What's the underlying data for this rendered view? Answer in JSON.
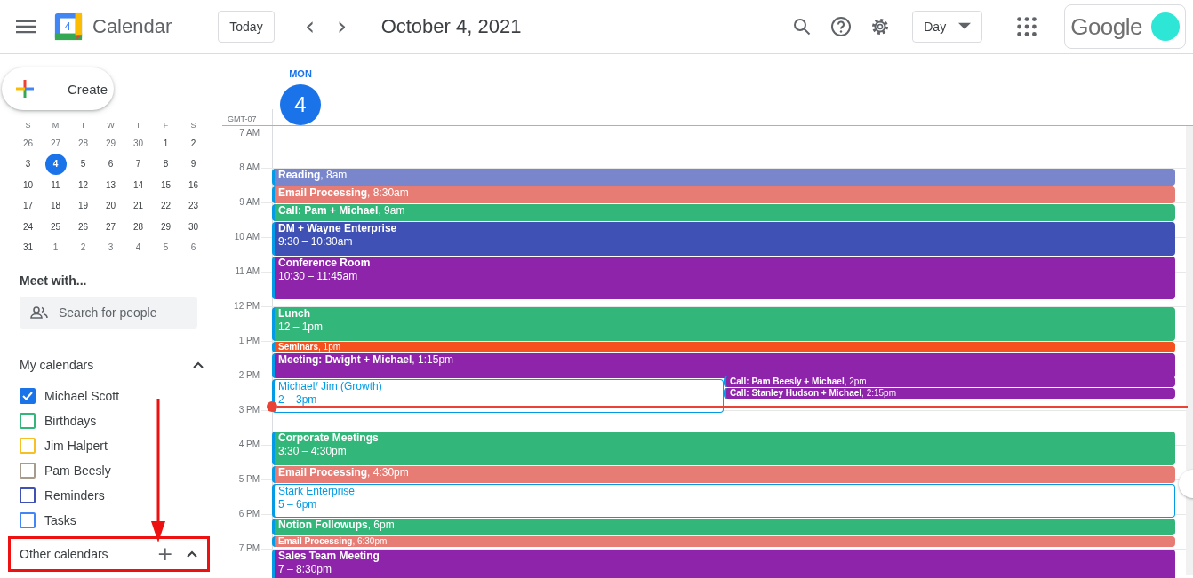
{
  "header": {
    "app_name": "Calendar",
    "logo_day": "4",
    "today_button": "Today",
    "prev": "‹",
    "next": "›",
    "date_title": "October 4, 2021",
    "view_select": "Day",
    "account_brand": "Google"
  },
  "sidebar": {
    "create_button": "Create",
    "mini_calendar": {
      "weekdays": [
        "S",
        "M",
        "T",
        "W",
        "T",
        "F",
        "S"
      ],
      "weeks": [
        [
          {
            "day": "26",
            "other_month": true,
            "selected": false
          },
          {
            "day": "27",
            "other_month": true,
            "selected": false
          },
          {
            "day": "28",
            "other_month": true,
            "selected": false
          },
          {
            "day": "29",
            "other_month": true,
            "selected": false
          },
          {
            "day": "30",
            "other_month": true,
            "selected": false
          },
          {
            "day": "1",
            "other_month": false,
            "selected": false
          },
          {
            "day": "2",
            "other_month": false,
            "selected": false
          }
        ],
        [
          {
            "day": "3",
            "other_month": false,
            "selected": false
          },
          {
            "day": "4",
            "other_month": false,
            "selected": true
          },
          {
            "day": "5",
            "other_month": false,
            "selected": false
          },
          {
            "day": "6",
            "other_month": false,
            "selected": false
          },
          {
            "day": "7",
            "other_month": false,
            "selected": false
          },
          {
            "day": "8",
            "other_month": false,
            "selected": false
          },
          {
            "day": "9",
            "other_month": false,
            "selected": false
          }
        ],
        [
          {
            "day": "10",
            "other_month": false,
            "selected": false
          },
          {
            "day": "11",
            "other_month": false,
            "selected": false
          },
          {
            "day": "12",
            "other_month": false,
            "selected": false
          },
          {
            "day": "13",
            "other_month": false,
            "selected": false
          },
          {
            "day": "14",
            "other_month": false,
            "selected": false
          },
          {
            "day": "15",
            "other_month": false,
            "selected": false
          },
          {
            "day": "16",
            "other_month": false,
            "selected": false
          }
        ],
        [
          {
            "day": "17",
            "other_month": false,
            "selected": false
          },
          {
            "day": "18",
            "other_month": false,
            "selected": false
          },
          {
            "day": "19",
            "other_month": false,
            "selected": false
          },
          {
            "day": "20",
            "other_month": false,
            "selected": false
          },
          {
            "day": "21",
            "other_month": false,
            "selected": false
          },
          {
            "day": "22",
            "other_month": false,
            "selected": false
          },
          {
            "day": "23",
            "other_month": false,
            "selected": false
          }
        ],
        [
          {
            "day": "24",
            "other_month": false,
            "selected": false
          },
          {
            "day": "25",
            "other_month": false,
            "selected": false
          },
          {
            "day": "26",
            "other_month": false,
            "selected": false
          },
          {
            "day": "27",
            "other_month": false,
            "selected": false
          },
          {
            "day": "28",
            "other_month": false,
            "selected": false
          },
          {
            "day": "29",
            "other_month": false,
            "selected": false
          },
          {
            "day": "30",
            "other_month": false,
            "selected": false
          }
        ],
        [
          {
            "day": "31",
            "other_month": false,
            "selected": false
          },
          {
            "day": "1",
            "other_month": true,
            "selected": false
          },
          {
            "day": "2",
            "other_month": true,
            "selected": false
          },
          {
            "day": "3",
            "other_month": true,
            "selected": false
          },
          {
            "day": "4",
            "other_month": true,
            "selected": false
          },
          {
            "day": "5",
            "other_month": true,
            "selected": false
          },
          {
            "day": "6",
            "other_month": true,
            "selected": false
          }
        ]
      ]
    },
    "meet_with": {
      "title": "Meet with...",
      "placeholder": "Search for people"
    },
    "my_calendars": {
      "title": "My calendars",
      "expanded": true,
      "items": [
        {
          "label": "Michael Scott",
          "checked": true,
          "color": "#1a73e8"
        },
        {
          "label": "Birthdays",
          "checked": false,
          "color": "#33b679"
        },
        {
          "label": "Jim Halpert",
          "checked": false,
          "color": "#f6bf26"
        },
        {
          "label": "Pam Beesly",
          "checked": false,
          "color": "#a79b8e"
        },
        {
          "label": "Reminders",
          "checked": false,
          "color": "#3f51b5"
        },
        {
          "label": "Tasks",
          "checked": false,
          "color": "#4285f4"
        }
      ]
    },
    "other_calendars": {
      "title": "Other calendars",
      "add": "+",
      "expanded": true,
      "highlighted": true
    }
  },
  "day_view": {
    "weekday": "MON",
    "day": "4",
    "timezone": "GMT-07",
    "hours": [
      {
        "label": "7 AM",
        "now": false
      },
      {
        "label": "8 AM",
        "now": false,
        "events": [
          {
            "title": "**Reading**, 8am",
            "kind": "bar",
            "color": "#7986cb"
          },
          {
            "title": "**Email Processing**, 8:30am",
            "kind": "bar",
            "color": "#e67c73"
          }
        ]
      },
      {
        "label": "9 AM",
        "now": false,
        "events": [
          {
            "title": "**Call: Pam + Michael**, 9am",
            "kind": "bar",
            "color": "#33b679"
          },
          {
            "title": "DM + Wayne Enterprise",
            "time": "9:30 – 10:30am",
            "kind": "block",
            "color": "#3f51b5"
          }
        ]
      },
      {
        "label": "10 AM",
        "now": false,
        "events": [
          {
            "title": "Conference Room",
            "time": "10:30 – 11:45am",
            "kind": "tall",
            "color": "#8e24aa"
          }
        ]
      },
      {
        "label": "11 AM",
        "now": false
      },
      {
        "label": "12 PM",
        "now": false,
        "events": [
          {
            "title": "Lunch",
            "time": "12 – 1pm",
            "kind": "block",
            "color": "#33b679"
          }
        ]
      },
      {
        "label": "1 PM",
        "now": false,
        "events": [
          {
            "title": "**Seminars**, 1pm",
            "kind": "thin",
            "color": "#f4511e"
          },
          {
            "title": "**Meeting: Dwight + Michael**, 1:15pm",
            "kind": "medium",
            "color": "#8e24aa"
          }
        ]
      },
      {
        "label": "2 PM",
        "now": true,
        "events": [
          {
            "title": "Michael/ Jim (Growth)",
            "time": "2 – 3pm",
            "kind": "overlap",
            "color": "#039be5"
          },
          {
            "title": "**Call: Pam Beesly + Michael**, 2pm",
            "kind": "side",
            "color": "#8e24aa"
          },
          {
            "title": "**Call: Stanley Hudson + Michael**, 2:15pm",
            "kind": "side",
            "color": "#8e24aa"
          }
        ]
      },
      {
        "label": "3 PM",
        "now": false,
        "events": [
          {
            "title": "Corporate Meetings",
            "time": "3:30 – 4:30pm",
            "kind": "delayed",
            "color": "#33b679"
          }
        ]
      },
      {
        "label": "4 PM",
        "now": false,
        "events": [
          {
            "title": "**Email Processing**, 4:30pm",
            "kind": "bar",
            "color": "#e67c73"
          }
        ]
      },
      {
        "label": "5 PM",
        "now": false,
        "events": [
          {
            "title": "Stark Enterprise",
            "time": "5 – 6pm",
            "kind": "outlined",
            "color": "#039be5"
          }
        ]
      },
      {
        "label": "6 PM",
        "now": false,
        "events": [
          {
            "title": "**Notion Followups**, 6pm",
            "kind": "bar",
            "color": "#33b679"
          },
          {
            "title": "**Email Processing**, 6:30pm",
            "kind": "thin",
            "color": "#e67c73"
          }
        ]
      },
      {
        "label": "7 PM",
        "now": false,
        "events": [
          {
            "title": "Sales Team Meeting",
            "time": "7 – 8:30pm",
            "kind": "long",
            "color": "#8e24aa"
          }
        ]
      }
    ]
  }
}
